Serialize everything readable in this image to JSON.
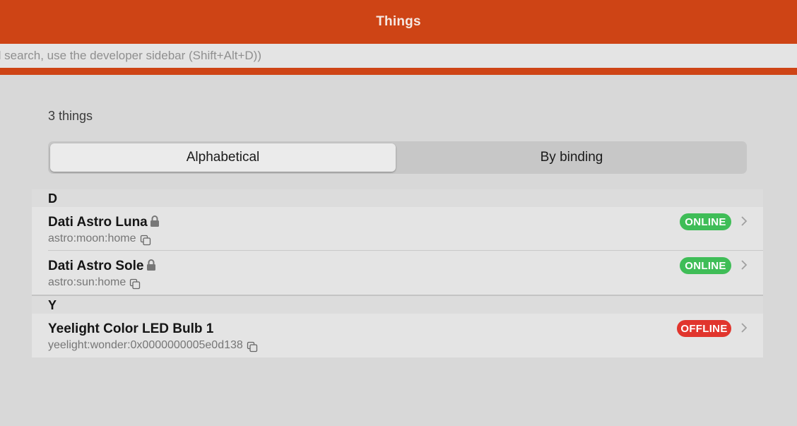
{
  "navbar": {
    "title": "Things"
  },
  "search": {
    "placeholder": "d search, use the developer sidebar (Shift+Alt+D))"
  },
  "summary": {
    "count_text": "3 things"
  },
  "sort_toggle": {
    "options": [
      {
        "label": "Alphabetical",
        "active": true
      },
      {
        "label": "By binding",
        "active": false
      }
    ]
  },
  "groups": [
    {
      "letter": "D",
      "items": [
        {
          "name": "Dati Astro Luna",
          "uid": "astro:moon:home",
          "status": "ONLINE",
          "locked": true
        },
        {
          "name": "Dati Astro Sole",
          "uid": "astro:sun:home",
          "status": "ONLINE",
          "locked": true
        }
      ]
    },
    {
      "letter": "Y",
      "items": [
        {
          "name": "Yeelight Color LED Bulb 1",
          "uid": "yeelight:wonder:0x0000000005e0d138",
          "status": "OFFLINE",
          "locked": false
        }
      ]
    }
  ],
  "colors": {
    "brand": "#ce4415",
    "online": "#3fbd57",
    "offline": "#e1352d"
  },
  "icons": {
    "lock": "lock-icon",
    "copy": "copy-icon",
    "chevron": "chevron-right-icon"
  }
}
